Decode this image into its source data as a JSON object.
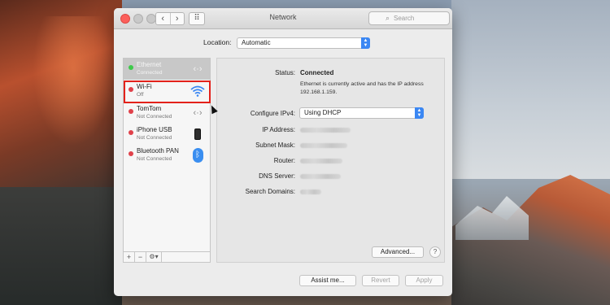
{
  "window": {
    "title": "Network",
    "search_placeholder": "Search",
    "nav_back": "‹",
    "nav_forward": "›",
    "grid_icon": "⠿"
  },
  "location": {
    "label": "Location:",
    "value": "Automatic"
  },
  "services": [
    {
      "name": "Ethernet",
      "status": "Connected",
      "dot_color": "#3ec94a",
      "icon": "ethernet-icon",
      "selected": true
    },
    {
      "name": "Wi-Fi",
      "status": "Off",
      "dot_color": "#e0414a",
      "icon": "wifi-icon",
      "selected": false,
      "highlighted": true
    },
    {
      "name": "TomTom",
      "status": "Not Connected",
      "dot_color": "#e0414a",
      "icon": "ethernet-icon"
    },
    {
      "name": "iPhone USB",
      "status": "Not Connected",
      "dot_color": "#e0414a",
      "icon": "iphone-icon"
    },
    {
      "name": "Bluetooth PAN",
      "status": "Not Connected",
      "dot_color": "#e0414a",
      "icon": "bluetooth-icon"
    }
  ],
  "sidebar_controls": {
    "add": "+",
    "remove": "−",
    "gear": "⚙▾"
  },
  "detail": {
    "status_label": "Status:",
    "status_value": "Connected",
    "status_description": "Ethernet is currently active and has the IP address 192.168.1.159.",
    "configure_label": "Configure IPv4:",
    "configure_value": "Using DHCP",
    "ip_label": "IP Address:",
    "subnet_label": "Subnet Mask:",
    "router_label": "Router:",
    "dns_label": "DNS Server:",
    "search_domains_label": "Search Domains:",
    "advanced_button": "Advanced...",
    "help_button": "?"
  },
  "footer": {
    "assist": "Assist me...",
    "revert": "Revert",
    "apply": "Apply"
  },
  "colors": {
    "highlight_box": "#e3221b",
    "accent": "#3b87f3"
  }
}
